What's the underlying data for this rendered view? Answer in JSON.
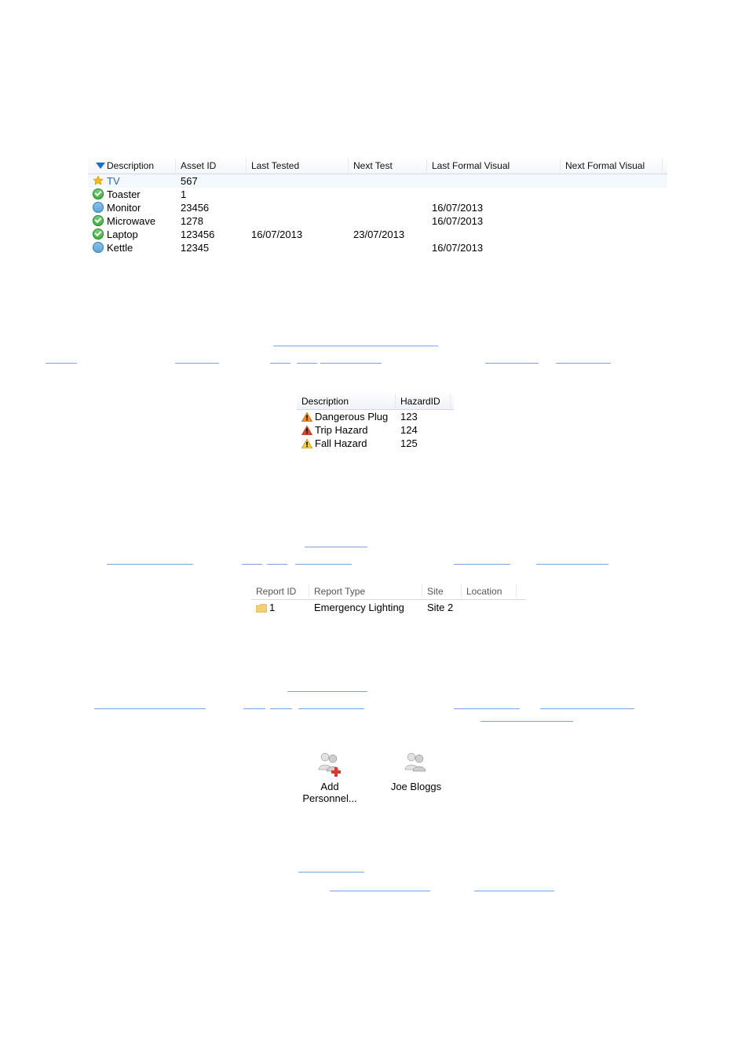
{
  "assets": {
    "headers": {
      "description": "Description",
      "asset_id": "Asset ID",
      "last_tested": "Last Tested",
      "next_test": "Next Test",
      "last_formal_visual": "Last Formal Visual",
      "next_formal_visual": "Next Formal Visual"
    },
    "rows": [
      {
        "icon": "star",
        "description": "TV",
        "asset_id": "567",
        "last_tested": "",
        "next_test": "",
        "last_formal_visual": "",
        "next_formal_visual": "",
        "selected": true
      },
      {
        "icon": "pass",
        "description": "Toaster",
        "asset_id": "1",
        "last_tested": "",
        "next_test": "",
        "last_formal_visual": "",
        "next_formal_visual": ""
      },
      {
        "icon": "blue",
        "description": "Monitor",
        "asset_id": "23456",
        "last_tested": "",
        "next_test": "",
        "last_formal_visual": "16/07/2013",
        "next_formal_visual": ""
      },
      {
        "icon": "pass",
        "description": "Microwave",
        "asset_id": "1278",
        "last_tested": "",
        "next_test": "",
        "last_formal_visual": "16/07/2013",
        "next_formal_visual": ""
      },
      {
        "icon": "pass",
        "description": "Laptop",
        "asset_id": "123456",
        "last_tested": "16/07/2013",
        "next_test": "23/07/2013",
        "last_formal_visual": "",
        "next_formal_visual": ""
      },
      {
        "icon": "blue",
        "description": "Kettle",
        "asset_id": "12345",
        "last_tested": "",
        "next_test": "",
        "last_formal_visual": "16/07/2013",
        "next_formal_visual": ""
      }
    ]
  },
  "hazards": {
    "headers": {
      "description": "Description",
      "hazard_id": "HazardID"
    },
    "rows": [
      {
        "color": "orange",
        "description": "Dangerous Plug",
        "hazard_id": "123"
      },
      {
        "color": "red",
        "description": "Trip Hazard",
        "hazard_id": "124"
      },
      {
        "color": "yellow",
        "description": "Fall Hazard",
        "hazard_id": "125"
      }
    ]
  },
  "reports": {
    "headers": {
      "report_id": "Report ID",
      "report_type": "Report Type",
      "site": "Site",
      "location": "Location"
    },
    "rows": [
      {
        "report_id": "1",
        "report_type": "Emergency Lighting",
        "site": "Site 2",
        "location": ""
      }
    ]
  },
  "personnel": {
    "add_label": "Add Personnel...",
    "person_label": "Joe Bloggs"
  }
}
